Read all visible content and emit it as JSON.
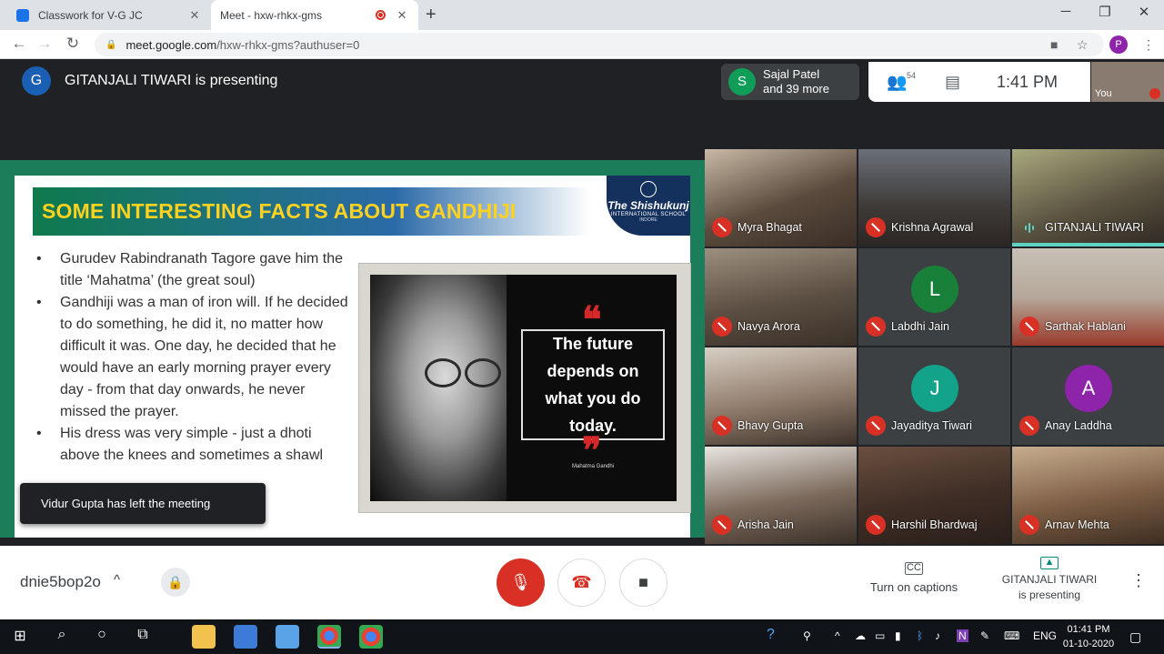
{
  "browser": {
    "tabs": [
      {
        "title": "Classwork for V-G JC",
        "active": false
      },
      {
        "title": "Meet - hxw-rhkx-gms",
        "active": true
      }
    ],
    "url_host": "meet.google.com",
    "url_path": "/hxw-rhkx-gms?authuser=0",
    "profile_initial": "P",
    "window_controls": {
      "minimize": "─",
      "restore": "❐",
      "close": "✕"
    }
  },
  "meet": {
    "presenter_initial": "G",
    "presenting_text": "GITANJALI TIWARI is presenting",
    "others_initial": "S",
    "others_line1": "Sajal Patel",
    "others_line2": "and 39 more",
    "participant_count": "54",
    "time": "1:41 PM",
    "self_label": "You",
    "toast": "Vidur Gupta has left the meeting"
  },
  "slide": {
    "title": "SOME INTERESTING FACTS ABOUT GANDHIJI",
    "school_line1": "The Shishukunj",
    "school_line2": "INTERNATIONAL SCHOOL",
    "school_line3": "INDORE",
    "bullets": [
      "Gurudev Rabindranath Tagore gave him the  title ‘Mahatma’ (the great soul)",
      "Gandhiji was a man of iron will. If he decided to do something, he did it, no matter how difficult it was. One day, he decided that he would have an early morning prayer every day - from that day onwards, he never missed the prayer.",
      "His dress was very simple - just a dhoti above the knees and sometimes a shawl"
    ],
    "quote": "The future depends on what you do today.",
    "quote_author": "Mahatma Gandhi",
    "open_quote": "❝",
    "close_quote": "❞"
  },
  "participants": [
    {
      "name": "Myra Bhagat",
      "initial": "",
      "muted": true
    },
    {
      "name": "Krishna Agrawal",
      "initial": "",
      "muted": true
    },
    {
      "name": "GITANJALI TIWARI",
      "initial": "",
      "muted": false,
      "speaking": true
    },
    {
      "name": "Navya Arora",
      "initial": "",
      "muted": true
    },
    {
      "name": "Labdhi Jain",
      "initial": "L",
      "muted": true,
      "color": "#188038"
    },
    {
      "name": "Sarthak Hablani",
      "initial": "",
      "muted": true
    },
    {
      "name": "Bhavy Gupta",
      "initial": "",
      "muted": true
    },
    {
      "name": "Jayaditya Tiwari",
      "initial": "J",
      "muted": true,
      "color": "#12a38a"
    },
    {
      "name": "Anay Laddha",
      "initial": "A",
      "muted": true,
      "color": "#8e24aa"
    },
    {
      "name": "Arisha Jain",
      "initial": "",
      "muted": true
    },
    {
      "name": "Harshil Bhardwaj",
      "initial": "",
      "muted": true
    },
    {
      "name": "Arnav Mehta",
      "initial": "",
      "muted": true
    }
  ],
  "controls": {
    "meeting_code": "dnie5bop2o",
    "captions_label": "Turn on captions",
    "presenting_line1": "GITANJALI TIWARI",
    "presenting_line2": "is presenting",
    "captions_icon": "CC",
    "present_icon": "▲"
  },
  "taskbar": {
    "time": "01:41 PM",
    "date": "01-10-2020",
    "language": "ENG"
  },
  "colors": {
    "mute_red": "#d93025",
    "slide_green": "#1b7d5a",
    "title_yellow": "#ffd21f",
    "speaking_teal": "#5ed3c4"
  }
}
